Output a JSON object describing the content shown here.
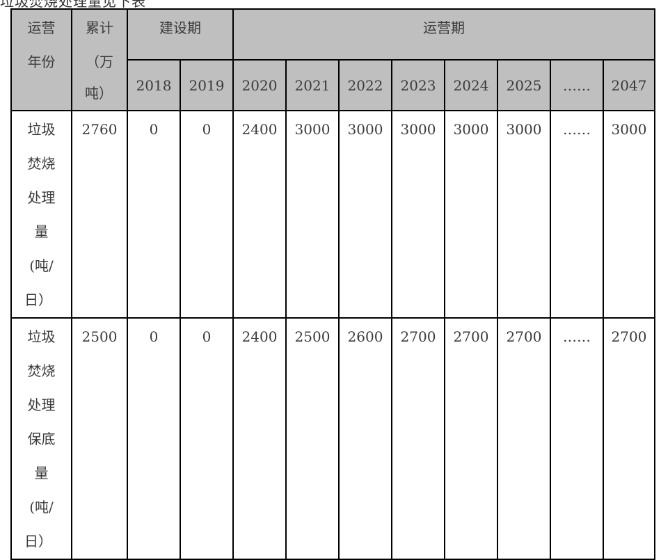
{
  "caption_fragment": "垃圾焚烧处理量见下表",
  "table": {
    "header": {
      "year_label_lines": [
        "运营",
        "年份"
      ],
      "cumulative_label_lines": [
        "累计",
        "（万",
        "吨）"
      ],
      "construction_period": "建设期",
      "operation_period": "运营期",
      "construction_years": [
        "2018",
        "2019"
      ],
      "operation_years": [
        "2020",
        "2021",
        "2022",
        "2023",
        "2024",
        "2025",
        "……",
        "2047"
      ]
    },
    "rows": [
      {
        "label_lines": [
          "垃圾",
          "焚烧",
          "处理",
          "量",
          "(吨/",
          "日）"
        ],
        "cumulative": "2760",
        "construction_values": [
          "0",
          "0"
        ],
        "operation_values": [
          "2400",
          "3000",
          "3000",
          "3000",
          "3000",
          "3000",
          "……",
          "3000"
        ]
      },
      {
        "label_lines": [
          "垃圾",
          "焚烧",
          "处理",
          "保底",
          "量",
          "(吨/",
          "日）"
        ],
        "cumulative": "2500",
        "construction_values": [
          "0",
          "0"
        ],
        "operation_values": [
          "2400",
          "2500",
          "2600",
          "2700",
          "2700",
          "2700",
          "……",
          "2700"
        ]
      }
    ]
  }
}
